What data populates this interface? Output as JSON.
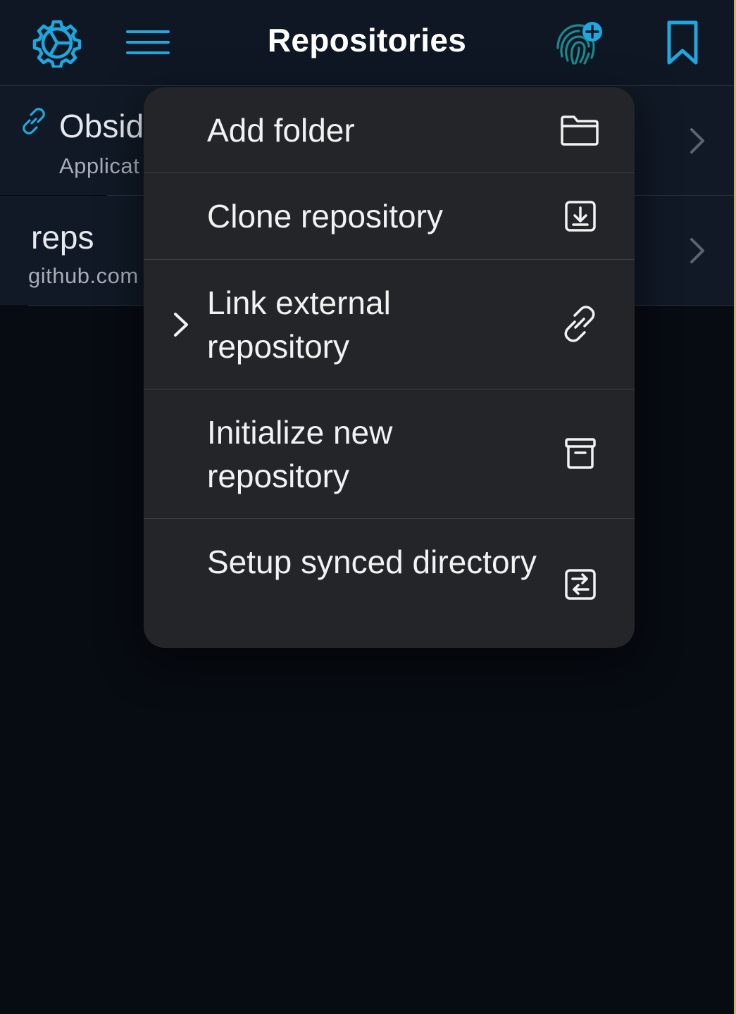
{
  "header": {
    "title": "Repositories",
    "icons": [
      "gear-icon",
      "hamburger-menu-icon",
      "fingerprint-plus-icon",
      "bookmark-icon"
    ]
  },
  "repos": [
    {
      "name": "Obsid",
      "subtitle": "Applicat",
      "icon": "link-icon"
    },
    {
      "name": "reps",
      "subtitle": "github.com"
    }
  ],
  "menu": {
    "items": [
      {
        "label": "Add folder",
        "icon": "folder-icon"
      },
      {
        "label": "Clone repository",
        "icon": "download-box-icon"
      },
      {
        "label": "Link external repository",
        "icon": "link-icon",
        "has_submenu": true
      },
      {
        "label": "Initialize new repository",
        "icon": "archive-box-icon"
      },
      {
        "label": "Setup synced directory",
        "icon": "sync-arrows-box-icon"
      }
    ]
  },
  "colors": {
    "accent": "#1ea8e0",
    "header_bg": "#0f1724",
    "menu_bg": "#242528",
    "background": "#070b12"
  }
}
